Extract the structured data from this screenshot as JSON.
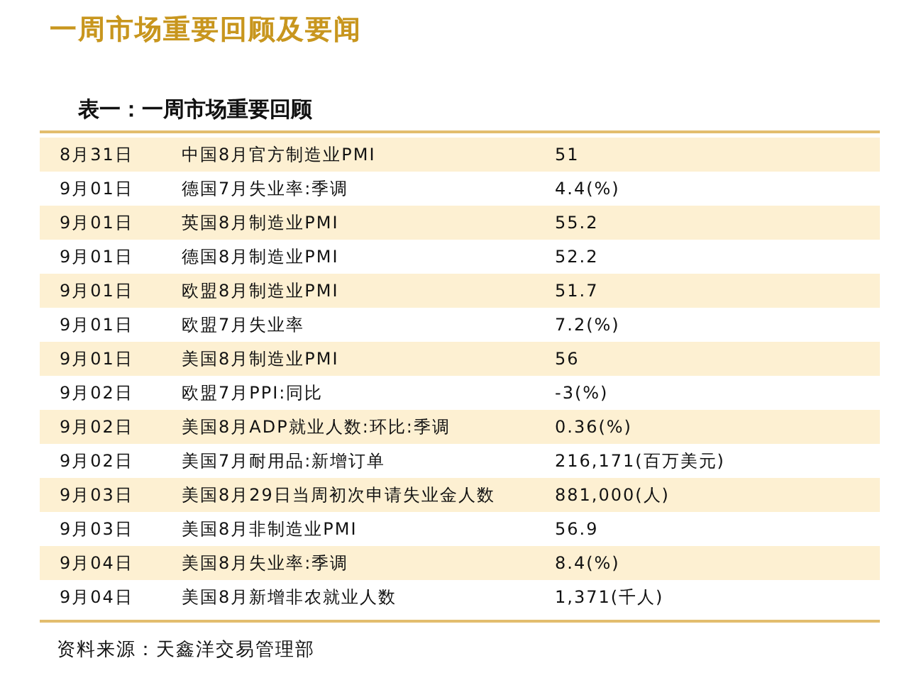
{
  "title": "一周市场重要回顾及要闻",
  "table": {
    "caption": "表一：一周市场重要回顾",
    "rows": [
      {
        "date": "8月31日",
        "event": "中国8月官方制造业PMI",
        "value": "51"
      },
      {
        "date": "9月01日",
        "event": "德国7月失业率:季调",
        "value": "4.4(%)"
      },
      {
        "date": "9月01日",
        "event": "英国8月制造业PMI",
        "value": "55.2"
      },
      {
        "date": "9月01日",
        "event": "德国8月制造业PMI",
        "value": "52.2"
      },
      {
        "date": "9月01日",
        "event": "欧盟8月制造业PMI",
        "value": "51.7"
      },
      {
        "date": "9月01日",
        "event": "欧盟7月失业率",
        "value": "7.2(%)"
      },
      {
        "date": "9月01日",
        "event": "美国8月制造业PMI",
        "value": "56"
      },
      {
        "date": "9月02日",
        "event": "欧盟7月PPI:同比",
        "value": "-3(%)"
      },
      {
        "date": "9月02日",
        "event": "美国8月ADP就业人数:环比:季调",
        "value": "0.36(%)"
      },
      {
        "date": "9月02日",
        "event": "美国7月耐用品:新增订单",
        "value": "216,171(百万美元)"
      },
      {
        "date": "9月03日",
        "event": "美国8月29日当周初次申请失业金人数",
        "value": "881,000(人)"
      },
      {
        "date": "9月03日",
        "event": "美国8月非制造业PMI",
        "value": "56.9"
      },
      {
        "date": "9月04日",
        "event": "美国8月失业率:季调",
        "value": "8.4(%)"
      },
      {
        "date": "9月04日",
        "event": "美国8月新增非农就业人数",
        "value": "1,371(千人)"
      }
    ],
    "source": "资料来源：天鑫洋交易管理部"
  }
}
